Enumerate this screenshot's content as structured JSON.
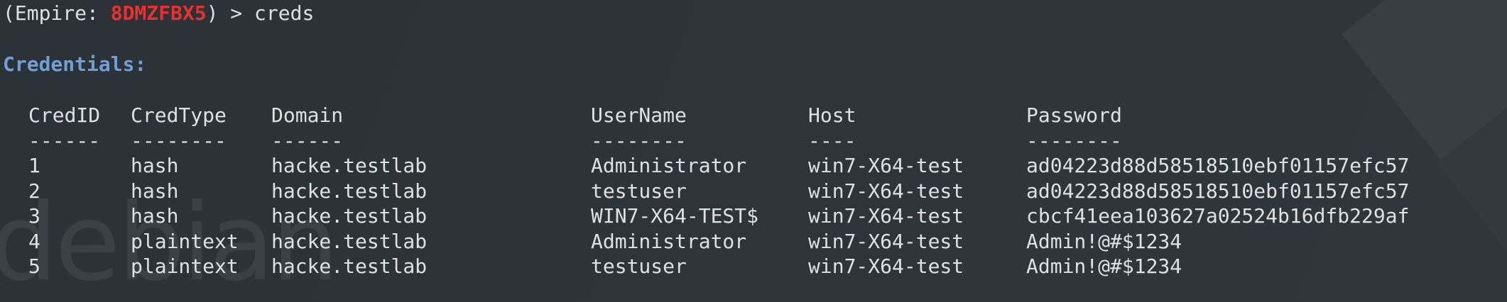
{
  "prompt": {
    "prefix": "(Empire: ",
    "agent": "8DMZFBX5",
    "suffix": ") > creds"
  },
  "section_title": "Credentials:",
  "watermark": "debian",
  "table": {
    "headers": [
      "CredID",
      "CredType",
      "Domain",
      "UserName",
      "Host",
      "Password"
    ],
    "separators": [
      "------",
      "--------",
      "------",
      "--------",
      "----",
      "--------"
    ],
    "rows": [
      [
        "1",
        "hash",
        "hacke.testlab",
        "Administrator",
        "win7-X64-test",
        "ad04223d88d58518510ebf01157efc57"
      ],
      [
        "2",
        "hash",
        "hacke.testlab",
        "testuser",
        "win7-X64-test",
        "ad04223d88d58518510ebf01157efc57"
      ],
      [
        "3",
        "hash",
        "hacke.testlab",
        "WIN7-X64-TEST$",
        "win7-X64-test",
        "cbcf41eea103627a02524b16dfb229af"
      ],
      [
        "4",
        "plaintext",
        "hacke.testlab",
        "Administrator",
        "win7-X64-test",
        "Admin!@#$1234"
      ],
      [
        "5",
        "plaintext",
        "hacke.testlab",
        "testuser",
        "win7-X64-test",
        "Admin!@#$1234"
      ]
    ]
  },
  "colors": {
    "background": "#2c3338",
    "text": "#e0e0e0",
    "agent": "#e8302f",
    "section_title": "#6f9fd6"
  }
}
